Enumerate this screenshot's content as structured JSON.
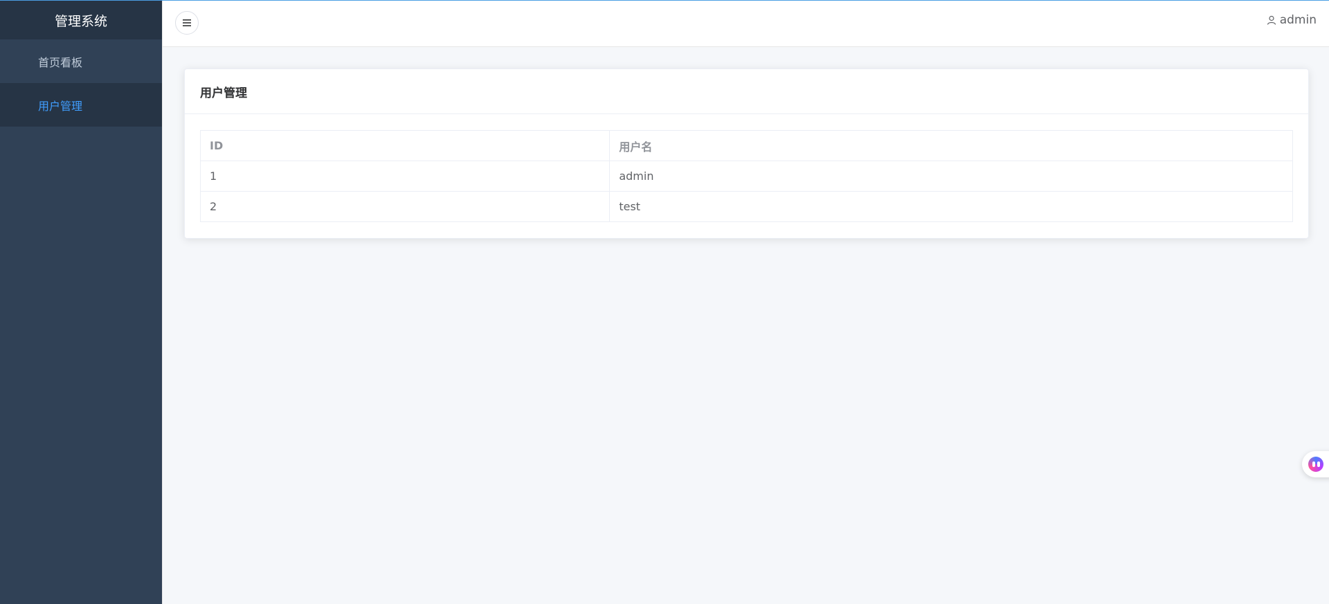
{
  "sidebar": {
    "brand": "管理系统",
    "items": [
      {
        "label": "首页看板",
        "active": false
      },
      {
        "label": "用户管理",
        "active": true
      }
    ]
  },
  "header": {
    "toggle_icon": "hamburger-icon",
    "user_icon": "user-icon",
    "username": "admin"
  },
  "card": {
    "title": "用户管理",
    "table": {
      "headers": [
        "ID",
        "用户名"
      ],
      "rows": [
        [
          "1",
          "admin"
        ],
        [
          "2",
          "test"
        ]
      ]
    }
  },
  "colors": {
    "sidebar_bg": "#304156",
    "sidebar_active_bg": "#263445",
    "accent": "#409eff"
  }
}
